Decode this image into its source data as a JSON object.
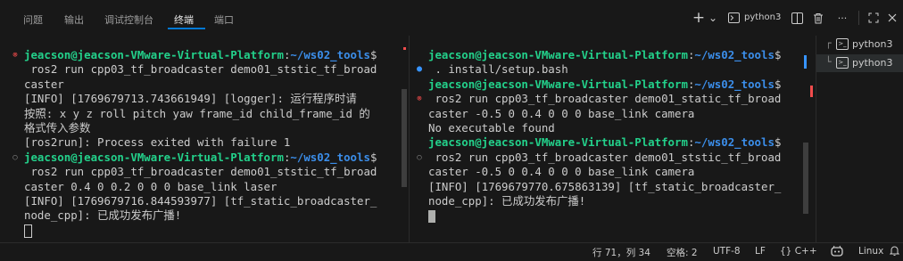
{
  "panel_tabs": [
    "问题",
    "输出",
    "调试控制台",
    "终端",
    "端口"
  ],
  "active_tab": "终端",
  "toolbar": {
    "new_terminal_glyph": "+",
    "dropdown_glyph": "⌄",
    "session_label": "python3",
    "more_glyph": "···"
  },
  "left_terminal": {
    "lines": [
      {
        "user": "jeacson@jeacson-VMware-Virtual-Platform",
        "path": "~/ws02_tools",
        "suffix": "$"
      },
      {
        "text": " ros2 run cpp03_tf_broadcaster demo01_ststic_tf_broad"
      },
      {
        "text": "caster"
      },
      {
        "text": "[INFO] [1769679713.743661949] [logger]: 运行程序时请"
      },
      {
        "text": "按照: x y z roll pitch yaw frame_id child_frame_id 的"
      },
      {
        "text": "格式传入参数"
      },
      {
        "text": "[ros2run]: Process exited with failure 1"
      },
      {
        "user": "jeacson@jeacson-VMware-Virtual-Platform",
        "path": "~/ws02_tools",
        "suffix": "$"
      },
      {
        "text": " ros2 run cpp03_tf_broadcaster demo01_ststic_tf_broad"
      },
      {
        "text": "caster 0.4 0 0.2 0 0 0 base_link laser"
      },
      {
        "text": "[INFO] [1769679716.844593977] [tf_static_broadcaster_"
      },
      {
        "text": "node_cpp]: 已成功发布广播!"
      }
    ]
  },
  "right_terminal": {
    "lines": [
      {
        "user": "jeacson@jeacson-VMware-Virtual-Platform",
        "path": "~/ws02_tools",
        "suffix": "$"
      },
      {
        "text": " . install/setup.bash"
      },
      {
        "user": "jeacson@jeacson-VMware-Virtual-Platform",
        "path": "~/ws02_tools",
        "suffix": "$"
      },
      {
        "text": " ros2 run cpp03_tf_broadcaster demo01_static_tf_broad"
      },
      {
        "text": "caster -0.5 0 0.4 0 0 0 base_link camera"
      },
      {
        "text": "No executable found"
      },
      {
        "user": "jeacson@jeacson-VMware-Virtual-Platform",
        "path": "~/ws02_tools",
        "suffix": "$"
      },
      {
        "text": " ros2 run cpp03_tf_broadcaster demo01_ststic_tf_broad"
      },
      {
        "text": "caster -0.5 0 0.4 0 0 0 base_link camera"
      },
      {
        "text": "[INFO] [1769679770.675863139] [tf_static_broadcaster_"
      },
      {
        "text": "node_cpp]: 已成功发布广播!"
      }
    ]
  },
  "sessions": [
    {
      "tree": "┌",
      "label": "python3",
      "selected": false
    },
    {
      "tree": "└",
      "label": "python3",
      "selected": true
    }
  ],
  "statusbar": {
    "position": "行 71，列 34",
    "spaces": "空格: 2",
    "encoding": "UTF-8",
    "eol": "LF",
    "language": "C++",
    "language_icon": "{}",
    "os": "Linux"
  },
  "colors": {
    "prompt_user": "#23d18b",
    "prompt_path": "#3b8eea",
    "error_decoration": "#f14c4c",
    "success_decoration": "#3794ff",
    "active_tab_underline": "#0078d4"
  }
}
